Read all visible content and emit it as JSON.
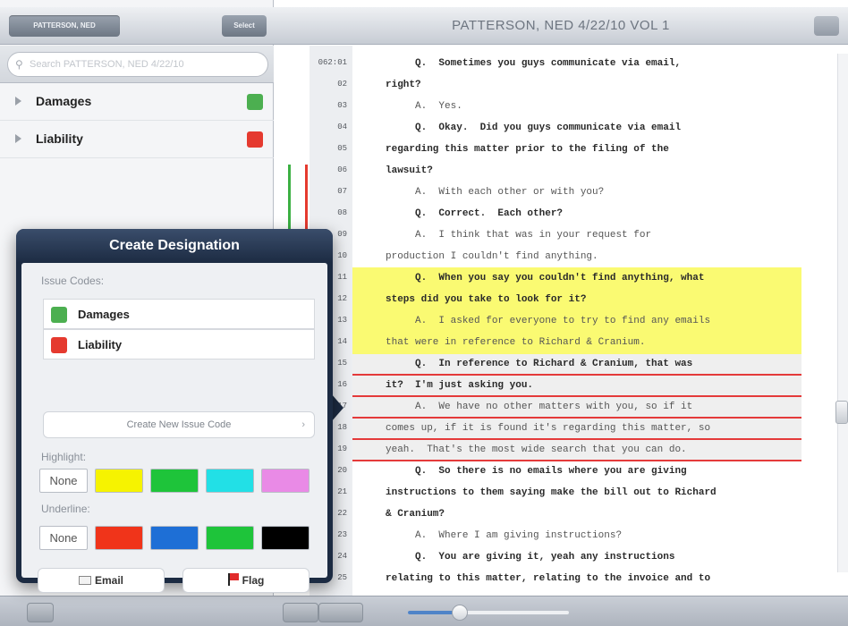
{
  "left_panel": {
    "back_label": "PATTERSON, NED",
    "select_label": "Select",
    "search_placeholder": "Search PATTERSON, NED 4/22/10",
    "issues": [
      {
        "label": "Damages",
        "color": "#4caf50"
      },
      {
        "label": "Liability",
        "color": "#e53a2f"
      }
    ]
  },
  "document": {
    "title": "PATTERSON, NED 4/22/10 VOL 1",
    "lines": [
      {
        "num": "062:01",
        "text": "     Q.  Sometimes you guys communicate via email,",
        "style": "b"
      },
      {
        "num": "02",
        "text": "right?",
        "style": "b"
      },
      {
        "num": "03",
        "text": "     A.  Yes.",
        "style": "l"
      },
      {
        "num": "04",
        "text": "     Q.  Okay.  Did you guys communicate via email",
        "style": "b"
      },
      {
        "num": "05",
        "text": "regarding this matter prior to the filing of the",
        "style": "b"
      },
      {
        "num": "06",
        "text": "lawsuit?",
        "style": "b"
      },
      {
        "num": "07",
        "text": "     A.  With each other or with you?",
        "style": "l"
      },
      {
        "num": "08",
        "text": "     Q.  Correct.  Each other?",
        "style": "b"
      },
      {
        "num": "09",
        "text": "     A.  I think that was in your request for",
        "style": "l"
      },
      {
        "num": "10",
        "text": "production I couldn't find anything.",
        "style": "l"
      },
      {
        "num": "11",
        "text": "     Q.  When you say you couldn't find anything, what",
        "style": "b"
      },
      {
        "num": "12",
        "text": "steps did you take to look for it?",
        "style": "b"
      },
      {
        "num": "13",
        "text": "     A.  I asked for everyone to try to find any emails",
        "style": "l"
      },
      {
        "num": "14",
        "text": "that were in reference to Richard & Cranium.",
        "style": "l"
      },
      {
        "num": "15",
        "text": "     Q.  In reference to Richard & Cranium, that was",
        "style": "b"
      },
      {
        "num": "16",
        "text": "it?  I'm just asking you.",
        "style": "b"
      },
      {
        "num": "17",
        "text": "     A.  We have no other matters with you, so if it",
        "style": "l"
      },
      {
        "num": "18",
        "text": "comes up, if it is found it's regarding this matter, so",
        "style": "l"
      },
      {
        "num": "19",
        "text": "yeah.  That's the most wide search that you can do.",
        "style": "l"
      },
      {
        "num": "20",
        "text": "     Q.  So there is no emails where you are giving",
        "style": "b"
      },
      {
        "num": "21",
        "text": "instructions to them saying make the bill out to Richard",
        "style": "b"
      },
      {
        "num": "22",
        "text": "& Cranium?",
        "style": "b"
      },
      {
        "num": "23",
        "text": "     A.  Where I am giving instructions?",
        "style": "l"
      },
      {
        "num": "24",
        "text": "     Q.  You are giving it, yeah any instructions",
        "style": "b"
      },
      {
        "num": "25",
        "text": "relating to this matter, relating to the invoice and to",
        "style": "b"
      }
    ],
    "zoom_level": 0.32,
    "highlight_color": "#fafa72",
    "underline_color": "#e43a3a"
  },
  "popover": {
    "title": "Create Designation",
    "issue_codes_label": "Issue Codes:",
    "issue_codes": [
      {
        "label": "Damages",
        "color": "#4caf50"
      },
      {
        "label": "Liability",
        "color": "#e53a2f"
      }
    ],
    "new_code_label": "Create New Issue Code",
    "highlight_label": "Highlight:",
    "highlight_none": "None",
    "highlight_colors": [
      "#f6f300",
      "#1ec43a",
      "#22e0e6",
      "#e98ae6"
    ],
    "underline_label": "Underline:",
    "underline_none": "None",
    "underline_colors": [
      "#f0341a",
      "#1e6fd6",
      "#1ec43a",
      "#000000"
    ],
    "email_label": "Email",
    "flag_label": "Flag"
  }
}
